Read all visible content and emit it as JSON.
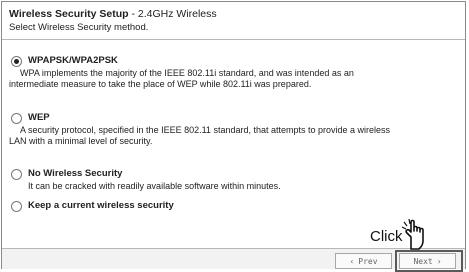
{
  "header": {
    "title_bold": "Wireless Security Setup",
    "title_rest": " - 2.4GHz Wireless",
    "subtitle": "Select Wireless Security method."
  },
  "options": [
    {
      "label": "WPAPSK/WPA2PSK",
      "selected": true,
      "desc_line1": "WPA implements the majority of the IEEE 802.11i standard, and was intended as an",
      "desc_line2": "intermediate measure to take the place of WEP while 802.11i was prepared."
    },
    {
      "label": "WEP",
      "selected": false,
      "desc_line1": "A security protocol, specified in the IEEE 802.11 standard, that attempts to provide a wireless",
      "desc_line2": "LAN with a minimal level of security."
    },
    {
      "label": "No Wireless Security",
      "selected": false,
      "desc_line1": "It can be cracked with readily available software within minutes."
    },
    {
      "label": "Keep a current wireless security",
      "selected": false
    }
  ],
  "footer": {
    "prev_label": "Prev",
    "next_label": "Next"
  },
  "callout": {
    "text": "Click",
    "icon": "pointing-hand-icon"
  }
}
